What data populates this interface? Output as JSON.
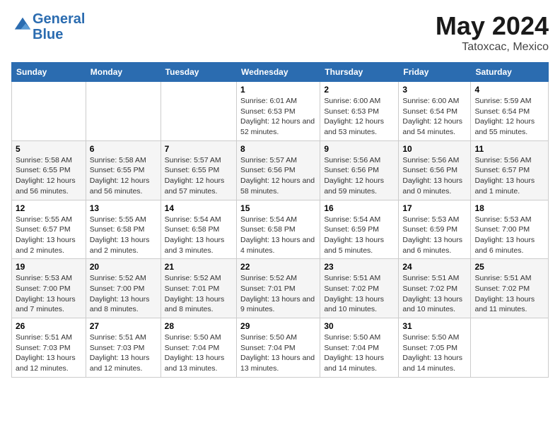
{
  "header": {
    "logo_line1": "General",
    "logo_line2": "Blue",
    "main_title": "May 2024",
    "subtitle": "Tatoxcac, Mexico"
  },
  "days_of_week": [
    "Sunday",
    "Monday",
    "Tuesday",
    "Wednesday",
    "Thursday",
    "Friday",
    "Saturday"
  ],
  "weeks": [
    [
      {
        "day": "",
        "sunrise": "",
        "sunset": "",
        "daylight": "",
        "empty": true
      },
      {
        "day": "",
        "sunrise": "",
        "sunset": "",
        "daylight": "",
        "empty": true
      },
      {
        "day": "",
        "sunrise": "",
        "sunset": "",
        "daylight": "",
        "empty": true
      },
      {
        "day": "1",
        "sunrise": "Sunrise: 6:01 AM",
        "sunset": "Sunset: 6:53 PM",
        "daylight": "Daylight: 12 hours and 52 minutes."
      },
      {
        "day": "2",
        "sunrise": "Sunrise: 6:00 AM",
        "sunset": "Sunset: 6:53 PM",
        "daylight": "Daylight: 12 hours and 53 minutes."
      },
      {
        "day": "3",
        "sunrise": "Sunrise: 6:00 AM",
        "sunset": "Sunset: 6:54 PM",
        "daylight": "Daylight: 12 hours and 54 minutes."
      },
      {
        "day": "4",
        "sunrise": "Sunrise: 5:59 AM",
        "sunset": "Sunset: 6:54 PM",
        "daylight": "Daylight: 12 hours and 55 minutes."
      }
    ],
    [
      {
        "day": "5",
        "sunrise": "Sunrise: 5:58 AM",
        "sunset": "Sunset: 6:55 PM",
        "daylight": "Daylight: 12 hours and 56 minutes."
      },
      {
        "day": "6",
        "sunrise": "Sunrise: 5:58 AM",
        "sunset": "Sunset: 6:55 PM",
        "daylight": "Daylight: 12 hours and 56 minutes."
      },
      {
        "day": "7",
        "sunrise": "Sunrise: 5:57 AM",
        "sunset": "Sunset: 6:55 PM",
        "daylight": "Daylight: 12 hours and 57 minutes."
      },
      {
        "day": "8",
        "sunrise": "Sunrise: 5:57 AM",
        "sunset": "Sunset: 6:56 PM",
        "daylight": "Daylight: 12 hours and 58 minutes."
      },
      {
        "day": "9",
        "sunrise": "Sunrise: 5:56 AM",
        "sunset": "Sunset: 6:56 PM",
        "daylight": "Daylight: 12 hours and 59 minutes."
      },
      {
        "day": "10",
        "sunrise": "Sunrise: 5:56 AM",
        "sunset": "Sunset: 6:56 PM",
        "daylight": "Daylight: 13 hours and 0 minutes."
      },
      {
        "day": "11",
        "sunrise": "Sunrise: 5:56 AM",
        "sunset": "Sunset: 6:57 PM",
        "daylight": "Daylight: 13 hours and 1 minute."
      }
    ],
    [
      {
        "day": "12",
        "sunrise": "Sunrise: 5:55 AM",
        "sunset": "Sunset: 6:57 PM",
        "daylight": "Daylight: 13 hours and 2 minutes."
      },
      {
        "day": "13",
        "sunrise": "Sunrise: 5:55 AM",
        "sunset": "Sunset: 6:58 PM",
        "daylight": "Daylight: 13 hours and 2 minutes."
      },
      {
        "day": "14",
        "sunrise": "Sunrise: 5:54 AM",
        "sunset": "Sunset: 6:58 PM",
        "daylight": "Daylight: 13 hours and 3 minutes."
      },
      {
        "day": "15",
        "sunrise": "Sunrise: 5:54 AM",
        "sunset": "Sunset: 6:58 PM",
        "daylight": "Daylight: 13 hours and 4 minutes."
      },
      {
        "day": "16",
        "sunrise": "Sunrise: 5:54 AM",
        "sunset": "Sunset: 6:59 PM",
        "daylight": "Daylight: 13 hours and 5 minutes."
      },
      {
        "day": "17",
        "sunrise": "Sunrise: 5:53 AM",
        "sunset": "Sunset: 6:59 PM",
        "daylight": "Daylight: 13 hours and 6 minutes."
      },
      {
        "day": "18",
        "sunrise": "Sunrise: 5:53 AM",
        "sunset": "Sunset: 7:00 PM",
        "daylight": "Daylight: 13 hours and 6 minutes."
      }
    ],
    [
      {
        "day": "19",
        "sunrise": "Sunrise: 5:53 AM",
        "sunset": "Sunset: 7:00 PM",
        "daylight": "Daylight: 13 hours and 7 minutes."
      },
      {
        "day": "20",
        "sunrise": "Sunrise: 5:52 AM",
        "sunset": "Sunset: 7:00 PM",
        "daylight": "Daylight: 13 hours and 8 minutes."
      },
      {
        "day": "21",
        "sunrise": "Sunrise: 5:52 AM",
        "sunset": "Sunset: 7:01 PM",
        "daylight": "Daylight: 13 hours and 8 minutes."
      },
      {
        "day": "22",
        "sunrise": "Sunrise: 5:52 AM",
        "sunset": "Sunset: 7:01 PM",
        "daylight": "Daylight: 13 hours and 9 minutes."
      },
      {
        "day": "23",
        "sunrise": "Sunrise: 5:51 AM",
        "sunset": "Sunset: 7:02 PM",
        "daylight": "Daylight: 13 hours and 10 minutes."
      },
      {
        "day": "24",
        "sunrise": "Sunrise: 5:51 AM",
        "sunset": "Sunset: 7:02 PM",
        "daylight": "Daylight: 13 hours and 10 minutes."
      },
      {
        "day": "25",
        "sunrise": "Sunrise: 5:51 AM",
        "sunset": "Sunset: 7:02 PM",
        "daylight": "Daylight: 13 hours and 11 minutes."
      }
    ],
    [
      {
        "day": "26",
        "sunrise": "Sunrise: 5:51 AM",
        "sunset": "Sunset: 7:03 PM",
        "daylight": "Daylight: 13 hours and 12 minutes."
      },
      {
        "day": "27",
        "sunrise": "Sunrise: 5:51 AM",
        "sunset": "Sunset: 7:03 PM",
        "daylight": "Daylight: 13 hours and 12 minutes."
      },
      {
        "day": "28",
        "sunrise": "Sunrise: 5:50 AM",
        "sunset": "Sunset: 7:04 PM",
        "daylight": "Daylight: 13 hours and 13 minutes."
      },
      {
        "day": "29",
        "sunrise": "Sunrise: 5:50 AM",
        "sunset": "Sunset: 7:04 PM",
        "daylight": "Daylight: 13 hours and 13 minutes."
      },
      {
        "day": "30",
        "sunrise": "Sunrise: 5:50 AM",
        "sunset": "Sunset: 7:04 PM",
        "daylight": "Daylight: 13 hours and 14 minutes."
      },
      {
        "day": "31",
        "sunrise": "Sunrise: 5:50 AM",
        "sunset": "Sunset: 7:05 PM",
        "daylight": "Daylight: 13 hours and 14 minutes."
      },
      {
        "day": "",
        "sunrise": "",
        "sunset": "",
        "daylight": "",
        "empty": true
      }
    ]
  ]
}
